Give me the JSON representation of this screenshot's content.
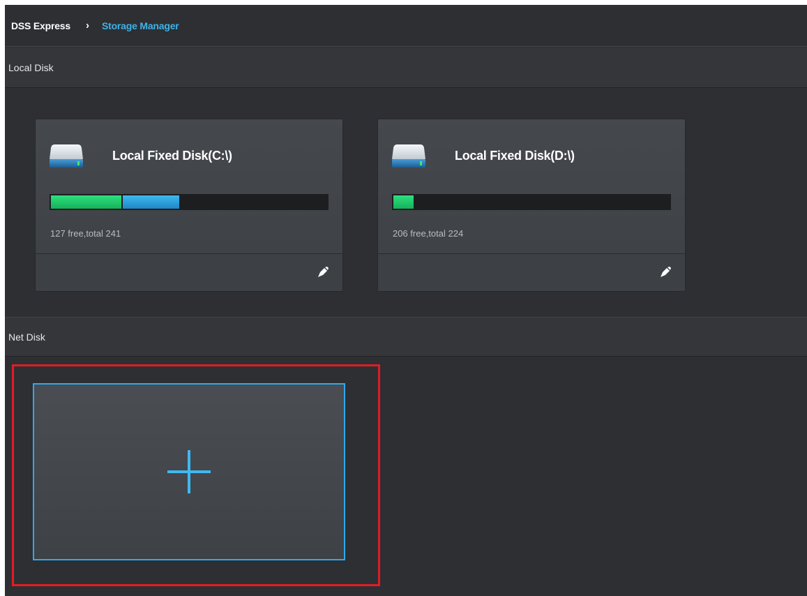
{
  "breadcrumb": {
    "home": "DSS Express",
    "separator": "›",
    "current": "Storage Manager"
  },
  "sections": {
    "local_disk": "Local Disk",
    "net_disk": "Net Disk"
  },
  "local_disks": [
    {
      "name": "Local Fixed Disk(C:\\)",
      "stats": "127 free,total 241",
      "usage_segments": [
        {
          "color": "#22c96c",
          "fraction": 0.255
        },
        {
          "color": "#2b9fdd",
          "fraction": 0.205
        }
      ],
      "icon": "hard-drive-icon",
      "edit_icon": "edit-icon"
    },
    {
      "name": "Local Fixed Disk(D:\\)",
      "stats": "206 free,total 224",
      "usage_segments": [
        {
          "color": "#22c96c",
          "fraction": 0.075
        }
      ],
      "icon": "hard-drive-icon",
      "edit_icon": "edit-icon"
    }
  ],
  "net_disk_add": {
    "icon": "plus-icon"
  },
  "colors": {
    "accent": "#3fb2e8",
    "highlight": "#e21c25",
    "background": "#2d2f33"
  }
}
